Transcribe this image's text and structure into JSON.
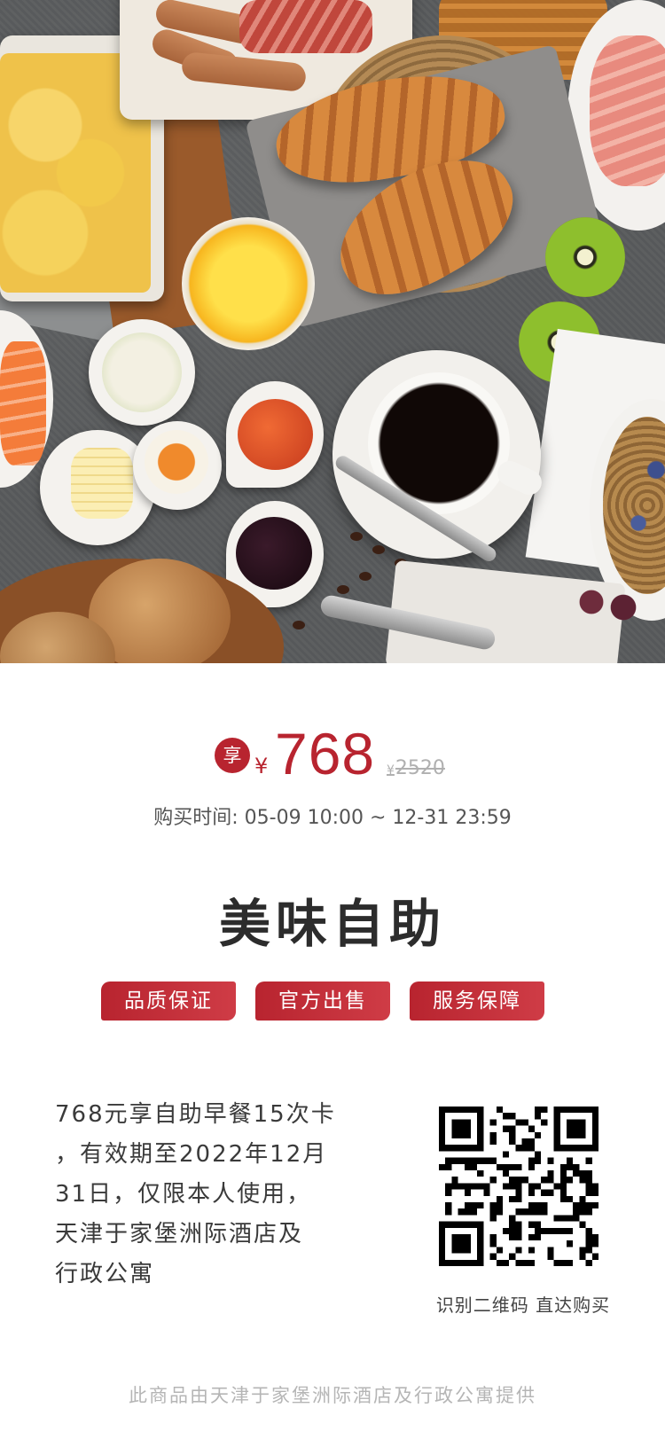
{
  "hero": {
    "image_name": "breakfast-buffet-photo"
  },
  "price": {
    "badge": "享",
    "currency": "¥",
    "value": "768",
    "original_currency": "¥",
    "original_value": "2520",
    "accent_color": "#b8242f"
  },
  "purchase_time": "购买时间:  05-09 10:00 ~ 12-31 23:59",
  "title": "美味自助",
  "tags": [
    "品质保证",
    "官方出售",
    "服务保障"
  ],
  "description_lines": [
    "768元享自助早餐15次卡",
    "，有效期至2022年12月",
    "31日，仅限本人使用，",
    "天津于家堡洲际酒店及",
    "行政公寓"
  ],
  "qr": {
    "caption": "识别二维码 直达购买"
  },
  "footer": "此商品由天津于家堡洲际酒店及行政公寓提供"
}
